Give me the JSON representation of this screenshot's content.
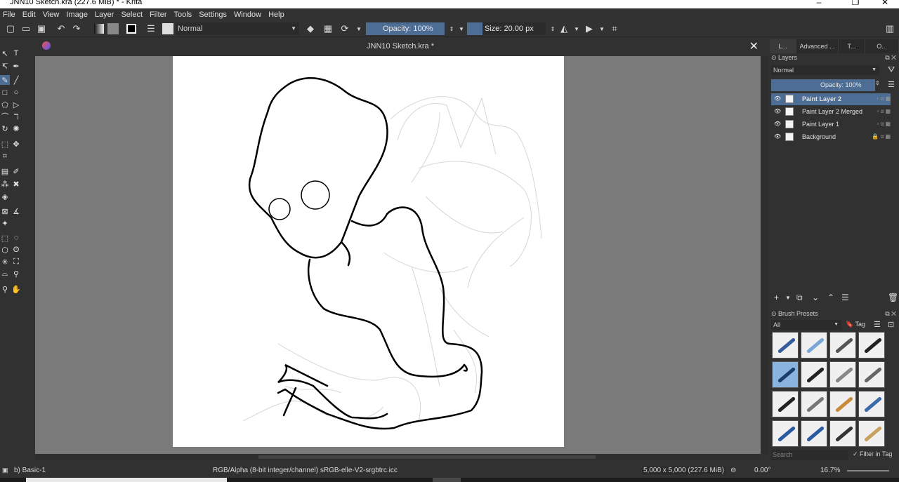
{
  "window": {
    "title": "JNN10 Sketch.kra (227.6 MiB)  * - Krita",
    "controls": [
      "–",
      "❐",
      "✕"
    ]
  },
  "menu": [
    "File",
    "Edit",
    "View",
    "Image",
    "Layer",
    "Select",
    "Filter",
    "Tools",
    "Settings",
    "Window",
    "Help"
  ],
  "toolbar": {
    "blend_mode": "Normal",
    "opacity_label": "Opacity: 100%",
    "opacity_value": 1.0,
    "size_label": "Size: 20.00 px"
  },
  "document": {
    "tab_title": "JNN10 Sketch.kra *"
  },
  "docker": {
    "tabs": [
      "L...",
      "Advanced ...",
      "T...",
      "O..."
    ],
    "layers_title": "Layers",
    "layer_blend": "Normal",
    "layer_opacity": "Opacity:  100%",
    "layers": [
      {
        "name": "Paint Layer 2",
        "active": true,
        "locked": false
      },
      {
        "name": "Paint Layer 2 Merged",
        "active": false,
        "locked": false
      },
      {
        "name": "Paint Layer 1",
        "active": false,
        "locked": false
      },
      {
        "name": "Background",
        "active": false,
        "locked": true
      }
    ],
    "brush_presets_title": "Brush Presets",
    "brush_filter": "All",
    "tag_label": "Tag",
    "search_placeholder": "Search",
    "filter_in_tag": "Filter in Tag"
  },
  "status": {
    "brush": "b) Basic-1",
    "color_info": "RGB/Alpha (8-bit integer/channel)  sRGB-elle-V2-srgbtrc.icc",
    "image_size": "5,000 x 5,000 (227.6 MiB)",
    "rotation": "0.00°",
    "zoom": "16.7%"
  },
  "colors": {
    "accent": "#4d6d94",
    "canvas_bg": "#7a7a7a",
    "ui_bg": "#313131"
  }
}
